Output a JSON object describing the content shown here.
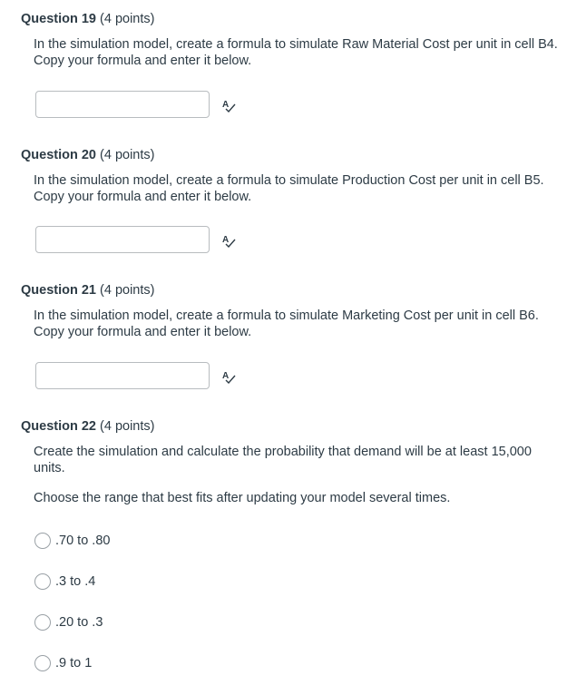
{
  "questions": [
    {
      "title": "Question 19",
      "points": "(4 points)",
      "text": "In the simulation model, create a formula to simulate Raw Material Cost per unit in cell B4.  Copy your formula and enter it below.",
      "answer_value": ""
    },
    {
      "title": "Question 20",
      "points": "(4 points)",
      "text": "In the simulation model, create a formula to simulate Production Cost per unit in cell B5.  Copy your formula and enter it below.",
      "answer_value": ""
    },
    {
      "title": "Question 21",
      "points": "(4 points)",
      "text": "In the simulation model, create a formula to simulate Marketing Cost per unit in cell B6.  Copy your formula and enter it below.",
      "answer_value": ""
    },
    {
      "title": "Question 22",
      "points": "(4 points)",
      "text": "Create the simulation and calculate the probability that demand will be at least 15,000 units.",
      "instruction": "Choose the range that best fits after updating your model several times.",
      "options": [
        {
          "label": ".70 to .80"
        },
        {
          "label": ".3 to .4"
        },
        {
          "label": ".20 to .3"
        },
        {
          "label": ".9 to 1"
        }
      ]
    }
  ],
  "icons": {
    "spellcheck": "spellcheck-icon"
  },
  "colors": {
    "text": "#2d3b45",
    "input_border": "#b8bcbf",
    "radio_border": "#9aa1a6",
    "background": "#ffffff"
  }
}
